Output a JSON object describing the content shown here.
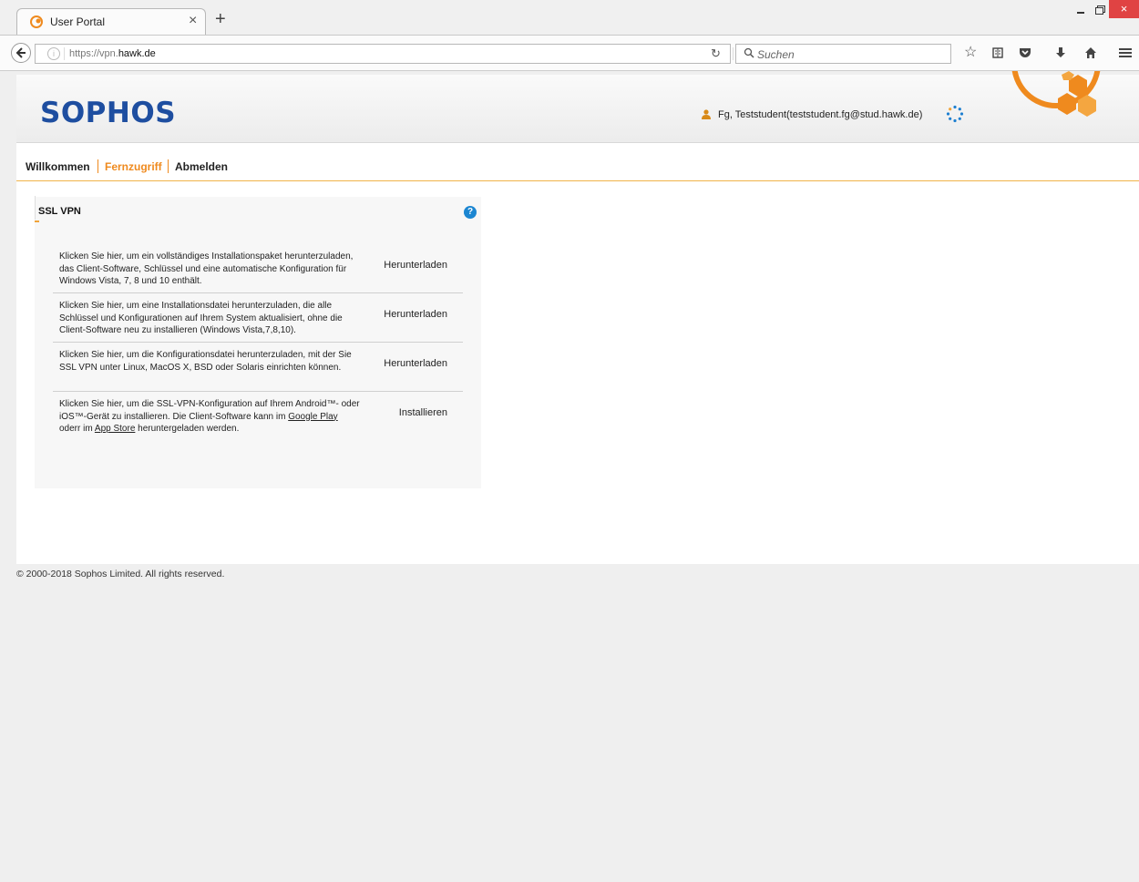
{
  "browser": {
    "tab_title": "User Portal",
    "url_prefix": "https://vpn.",
    "url_domain": "hawk.de",
    "search_placeholder": "Suchen",
    "close_symbol": "×",
    "new_tab_symbol": "+"
  },
  "header": {
    "logo": "SOPHOS",
    "user": "Fg, Teststudent(teststudent.fg@stud.hawk.de)"
  },
  "menu": {
    "items": [
      "Willkommen",
      "Fernzugriff",
      "Abmelden"
    ],
    "active": "Fernzugriff"
  },
  "panel": {
    "title": "SSL VPN",
    "help": "?",
    "rows": [
      {
        "desc": "Klicken Sie hier, um ein vollständiges Installationspaket herunterzuladen, das Client-Software, Schlüssel und eine automatische Konfiguration für Windows Vista, 7, 8 und 10 enthält.",
        "action": "Herunterladen"
      },
      {
        "desc": "Klicken Sie hier, um eine Installationsdatei herunterzuladen, die alle Schlüssel und Konfigurationen auf Ihrem System aktualisiert, ohne die Client-Software neu zu installieren (Windows Vista,7,8,10).",
        "action": "Herunterladen"
      },
      {
        "desc": "Klicken Sie hier, um die Konfigurationsdatei herunterzuladen, mit der Sie SSL VPN unter Linux, MacOS X, BSD oder Solaris einrichten können.",
        "action": "Herunterladen"
      },
      {
        "desc_part1": "Klicken Sie hier, um die SSL-VPN-Konfiguration auf Ihrem Android™- oder iOS™-Gerät zu installieren. Die Client-Software kann im ",
        "link1": "Google Play",
        "desc_part2": " oderr im ",
        "link2": "App Store",
        "desc_part3": " heruntergeladen werden.",
        "action": "Installieren"
      }
    ]
  },
  "footer": "© 2000-2018 Sophos Limited. All rights reserved.",
  "colors": {
    "brand_blue": "#1e4ea0",
    "accent_orange": "#ef8a1e",
    "help_blue": "#1c86d1"
  }
}
